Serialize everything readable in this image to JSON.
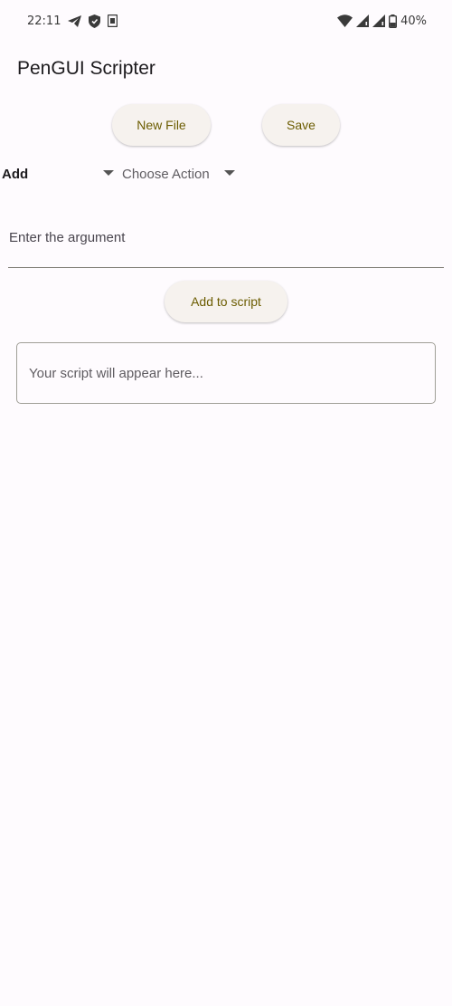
{
  "status_bar": {
    "time": "22:11",
    "battery_percent": "40%",
    "icons_left": [
      "telegram-icon",
      "shield-icon",
      "sim-icon"
    ],
    "icons_right": [
      "wifi-icon",
      "signal-icon",
      "signal-icon",
      "battery-icon"
    ]
  },
  "app": {
    "title": "PenGUI Scripter"
  },
  "toolbar": {
    "new_file_label": "New File",
    "save_label": "Save"
  },
  "add_row": {
    "label": "Add",
    "action_dropdown_value": "Choose Action"
  },
  "argument": {
    "placeholder": "Enter the argument"
  },
  "add_to_script_label": "Add to script",
  "script_output": {
    "placeholder": "Your script will appear here..."
  },
  "colors": {
    "background": "#fefbfe",
    "button_bg": "#f6f2ee",
    "button_text": "#6b5c00",
    "field_border": "#7d7b73"
  }
}
